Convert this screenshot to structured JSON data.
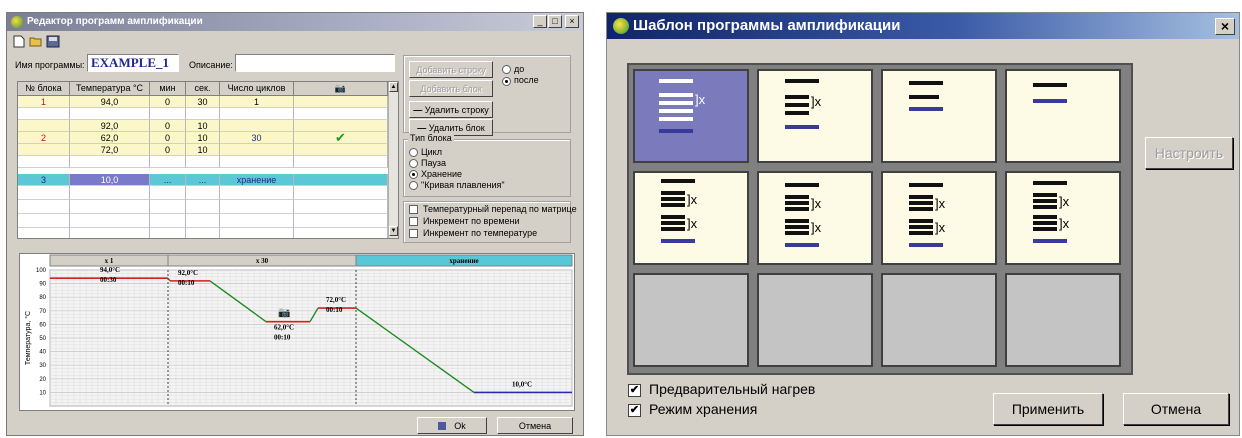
{
  "editor": {
    "title": "Редактор программ амплификации",
    "toolbar": {
      "new": "new-file-icon",
      "open": "open-folder-icon",
      "save": "save-icon"
    },
    "program_name_label": "Имя программы:",
    "program_name_value": "EXAMPLE_1",
    "description_label": "Описание:",
    "description_value": "",
    "table": {
      "headers": [
        "№ блока",
        "Температура °C",
        "мин",
        "сек.",
        "Число циклов",
        "camera-icon"
      ],
      "rows": [
        {
          "block": "1",
          "temp": "94,0",
          "min": "0",
          "sec": "30",
          "cycles": "1",
          "mark": ""
        },
        {
          "block": "",
          "temp": "",
          "min": "",
          "sec": "",
          "cycles": "",
          "mark": ""
        },
        {
          "block": "",
          "temp": "92,0",
          "min": "0",
          "sec": "10",
          "cycles": "",
          "mark": ""
        },
        {
          "block": "2",
          "temp": "62,0",
          "min": "0",
          "sec": "10",
          "cycles": "30",
          "mark": "✔"
        },
        {
          "block": "",
          "temp": "72,0",
          "min": "0",
          "sec": "10",
          "cycles": "",
          "mark": ""
        },
        {
          "block": "",
          "temp": "",
          "min": "",
          "sec": "",
          "cycles": "",
          "mark": ""
        },
        {
          "block": "3",
          "temp": "10,0",
          "min": "...",
          "sec": "...",
          "cycles": "хранение",
          "mark": ""
        }
      ]
    },
    "buttons": {
      "add_row": "Добавить строку",
      "add_block": "Добавить блок",
      "delete_row": "Удалить строку",
      "delete_block": "Удалить блок",
      "ok": "Ok",
      "cancel": "Отмена"
    },
    "position": {
      "before": "до",
      "after": "после",
      "selected": "after"
    },
    "block_type": {
      "title": "Тип блока",
      "options": [
        "Цикл",
        "Пауза",
        "Хранение",
        "\"Кривая плавления\""
      ],
      "selected": 2
    },
    "options": [
      {
        "label": "Температурный перепад по матрице",
        "checked": false
      },
      {
        "label": "Инкремент по времени",
        "checked": false
      },
      {
        "label": "Инкремент по температуре",
        "checked": false
      }
    ],
    "chart_data": {
      "type": "line",
      "ylabel": "Температура, °C",
      "ylim": [
        0,
        100
      ],
      "yticks": [
        10,
        20,
        30,
        40,
        50,
        60,
        70,
        80,
        90,
        100
      ],
      "blocks": [
        {
          "label": "x 1",
          "highlight": false
        },
        {
          "label": "x 30",
          "highlight": false
        },
        {
          "label": "хранение",
          "highlight": true
        }
      ],
      "steps": [
        {
          "temp": 94,
          "temp_label": "94,0°C",
          "time_label": "00:30",
          "block": 0
        },
        {
          "temp": 92,
          "temp_label": "92,0°C",
          "time_label": "00:10",
          "block": 1
        },
        {
          "temp": 62,
          "temp_label": "62,0°C",
          "time_label": "00:10",
          "block": 1,
          "camera": true
        },
        {
          "temp": 72,
          "temp_label": "72,0°C",
          "time_label": "00:10",
          "block": 1
        },
        {
          "temp": 10,
          "temp_label": "10,0°C",
          "time_label": "",
          "block": 2
        }
      ],
      "colors": {
        "hold": "#d42020",
        "ramp": "#1f8a1f",
        "storage": "#2a2ab0",
        "highlight": "#58c8d8"
      }
    }
  },
  "template": {
    "title": "Шаблон программы амплификации",
    "close": "×",
    "configure": "Настроить",
    "preheat_label": "Предварительный нагрев",
    "preheat_checked": true,
    "storage_label": "Режим хранения",
    "storage_checked": true,
    "apply": "Применить",
    "cancel": "Отмена",
    "tiles": [
      {
        "name": "tile-1-cycle",
        "selected": true,
        "bracket": "]x"
      },
      {
        "name": "tile-2",
        "selected": false,
        "bracket": "]x"
      },
      {
        "name": "tile-3",
        "selected": false,
        "bracket": ""
      },
      {
        "name": "tile-4",
        "selected": false,
        "bracket": ""
      },
      {
        "name": "tile-5",
        "selected": false,
        "bracket": "]x"
      },
      {
        "name": "tile-6",
        "selected": false,
        "bracket": "]x"
      },
      {
        "name": "tile-7",
        "selected": false,
        "bracket": "]x"
      },
      {
        "name": "tile-8",
        "selected": false,
        "bracket": "]x"
      },
      {
        "name": "tile-empty-1",
        "selected": false,
        "bracket": ""
      },
      {
        "name": "tile-empty-2",
        "selected": false,
        "bracket": ""
      },
      {
        "name": "tile-empty-3",
        "selected": false,
        "bracket": ""
      },
      {
        "name": "tile-empty-4",
        "selected": false,
        "bracket": ""
      }
    ]
  }
}
